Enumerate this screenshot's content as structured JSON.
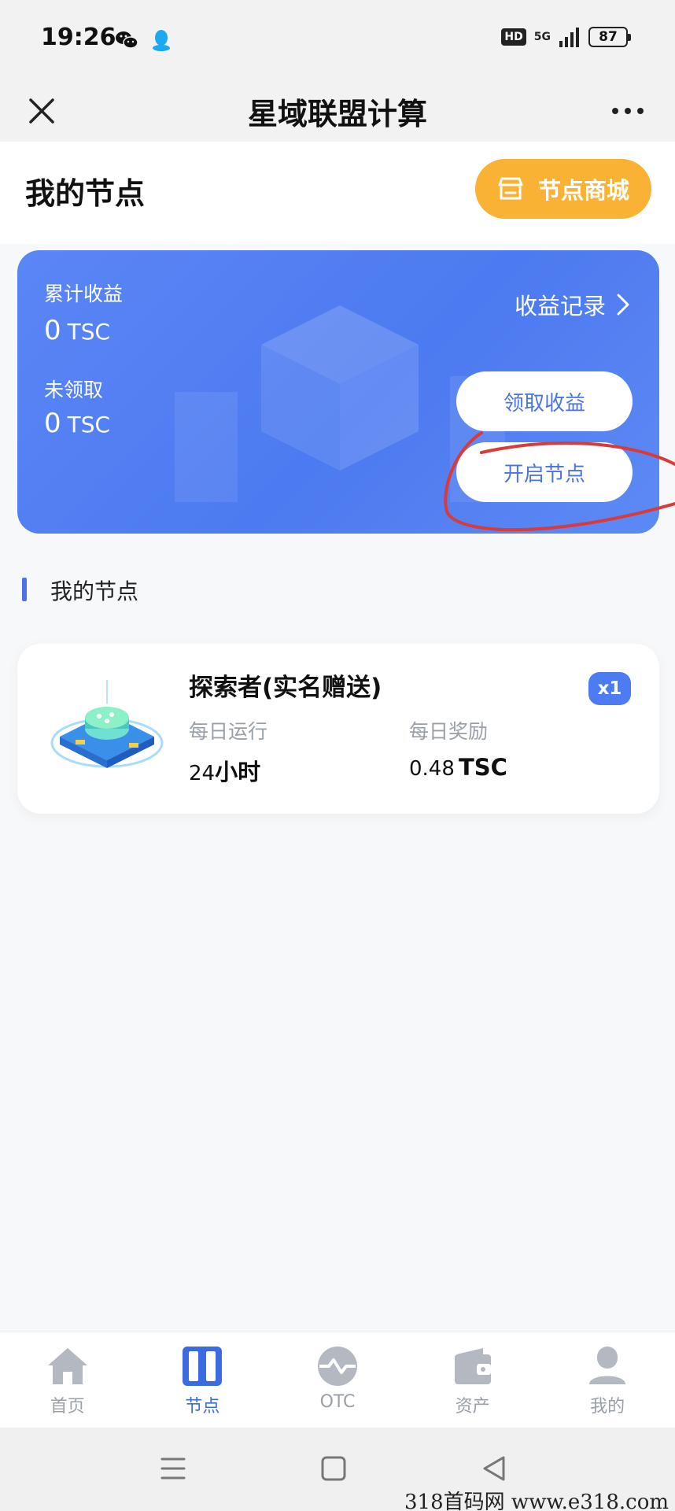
{
  "status_bar": {
    "time": "19:26",
    "hd": "HD",
    "network": "5G",
    "battery": "87"
  },
  "title_bar": {
    "title": "星域联盟计算"
  },
  "header": {
    "heading": "我的节点",
    "shop_button": "节点商城"
  },
  "earnings": {
    "total_label": "累计收益",
    "total_value": "0",
    "total_unit": "TSC",
    "unclaimed_label": "未领取",
    "unclaimed_value": "0",
    "unclaimed_unit": "TSC",
    "record_link": "收益记录",
    "claim_button": "领取收益",
    "start_button": "开启节点"
  },
  "nodes_section": {
    "title": "我的节点",
    "items": [
      {
        "name": "探索者(实名赠送)",
        "qty": "x1",
        "daily_run_label": "每日运行",
        "daily_run_value": "24",
        "daily_run_unit": "小时",
        "daily_reward_label": "每日奖励",
        "daily_reward_value": "0.48",
        "daily_reward_unit": "TSC"
      }
    ]
  },
  "bottom_nav": {
    "items": [
      {
        "label": "首页",
        "icon": "home-icon"
      },
      {
        "label": "节点",
        "icon": "node-icon",
        "active": true
      },
      {
        "label": "OTC",
        "icon": "otc-icon"
      },
      {
        "label": "资产",
        "icon": "wallet-icon"
      },
      {
        "label": "我的",
        "icon": "user-icon"
      }
    ]
  },
  "watermark": "318首码网  www.e318.com",
  "colors": {
    "accent": "#4a74e4",
    "card": "#5a86f6",
    "shop": "#f9b233"
  }
}
